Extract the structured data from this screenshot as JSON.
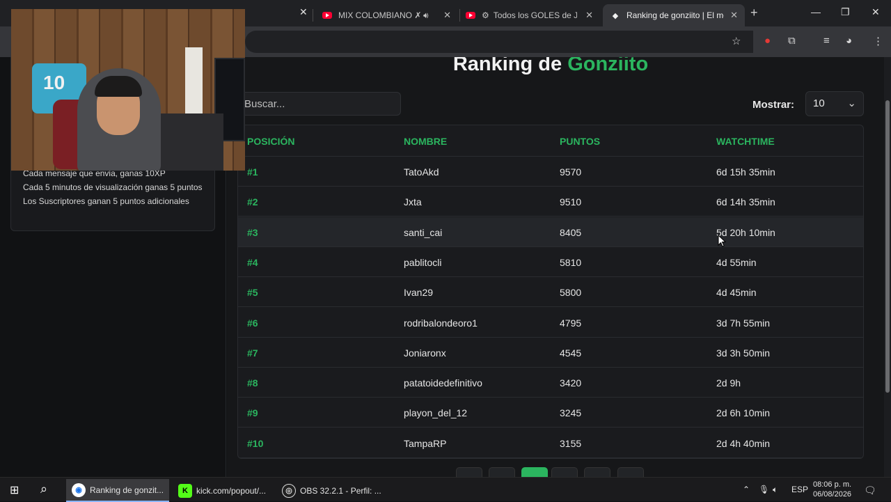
{
  "browser": {
    "tabs": [
      {
        "title": "MIX COLOMBIANO ✗ EI",
        "icon": "youtube-icon",
        "audio": true
      },
      {
        "title": "Todos los GOLES de JUA",
        "icon": "youtube-icon"
      },
      {
        "title": "Ranking de gonziito | El mej",
        "icon": "diamond-icon",
        "active": true
      }
    ],
    "new_tab": "+",
    "controls": {
      "minimize": "—",
      "maximize": "❐",
      "close": "✕"
    }
  },
  "info_card": {
    "lines": [
      "Cada mensaje que envia, ganas 10XP",
      "Cada 5 minutos de visualización ganas 5 puntos",
      "Los Suscriptores ganan 5 puntos adicionales"
    ]
  },
  "ranking": {
    "title_prefix": "Ranking de",
    "title_name": "Gonziito",
    "search_placeholder": "Buscar...",
    "show_label": "Mostrar:",
    "show_value": "10",
    "columns": [
      "POSICIÓN",
      "NOMBRE",
      "PUNTOS",
      "WATCHTIME"
    ],
    "rows": [
      {
        "pos": "#1",
        "name": "TatoAkd",
        "points": "9570",
        "watchtime": "6d 15h 35min"
      },
      {
        "pos": "#2",
        "name": "Jxta",
        "points": "9510",
        "watchtime": "6d 14h 35min"
      },
      {
        "pos": "#3",
        "name": "santi_cai",
        "points": "8405",
        "watchtime": "5d 20h 10min"
      },
      {
        "pos": "#4",
        "name": "pablitocli",
        "points": "5810",
        "watchtime": "4d 55min"
      },
      {
        "pos": "#5",
        "name": "Ivan29",
        "points": "5800",
        "watchtime": "4d 45min"
      },
      {
        "pos": "#6",
        "name": "rodribalondeoro1",
        "points": "4795",
        "watchtime": "3d 7h 55min"
      },
      {
        "pos": "#7",
        "name": "Joniaronx",
        "points": "4545",
        "watchtime": "3d 3h 50min"
      },
      {
        "pos": "#8",
        "name": "patatoidedefinitivo",
        "points": "3420",
        "watchtime": "2d 9h"
      },
      {
        "pos": "#9",
        "name": "playon_del_12",
        "points": "3245",
        "watchtime": "2d 6h 10min"
      },
      {
        "pos": "#10",
        "name": "TampaRP",
        "points": "3155",
        "watchtime": "2d 4h 40min"
      }
    ]
  },
  "webcam": {
    "jersey_number": "10"
  },
  "taskbar": {
    "items": [
      {
        "label": "Ranking de gonzit...",
        "active": true
      },
      {
        "label": "kick.com/popout/..."
      },
      {
        "label": "OBS 32.2.1 - Perfil: ..."
      }
    ],
    "language": "ESP",
    "time": "08:06 p. m.",
    "date": "06/08/2026"
  },
  "colors": {
    "accent": "#2bb55f",
    "background": "#111214"
  }
}
